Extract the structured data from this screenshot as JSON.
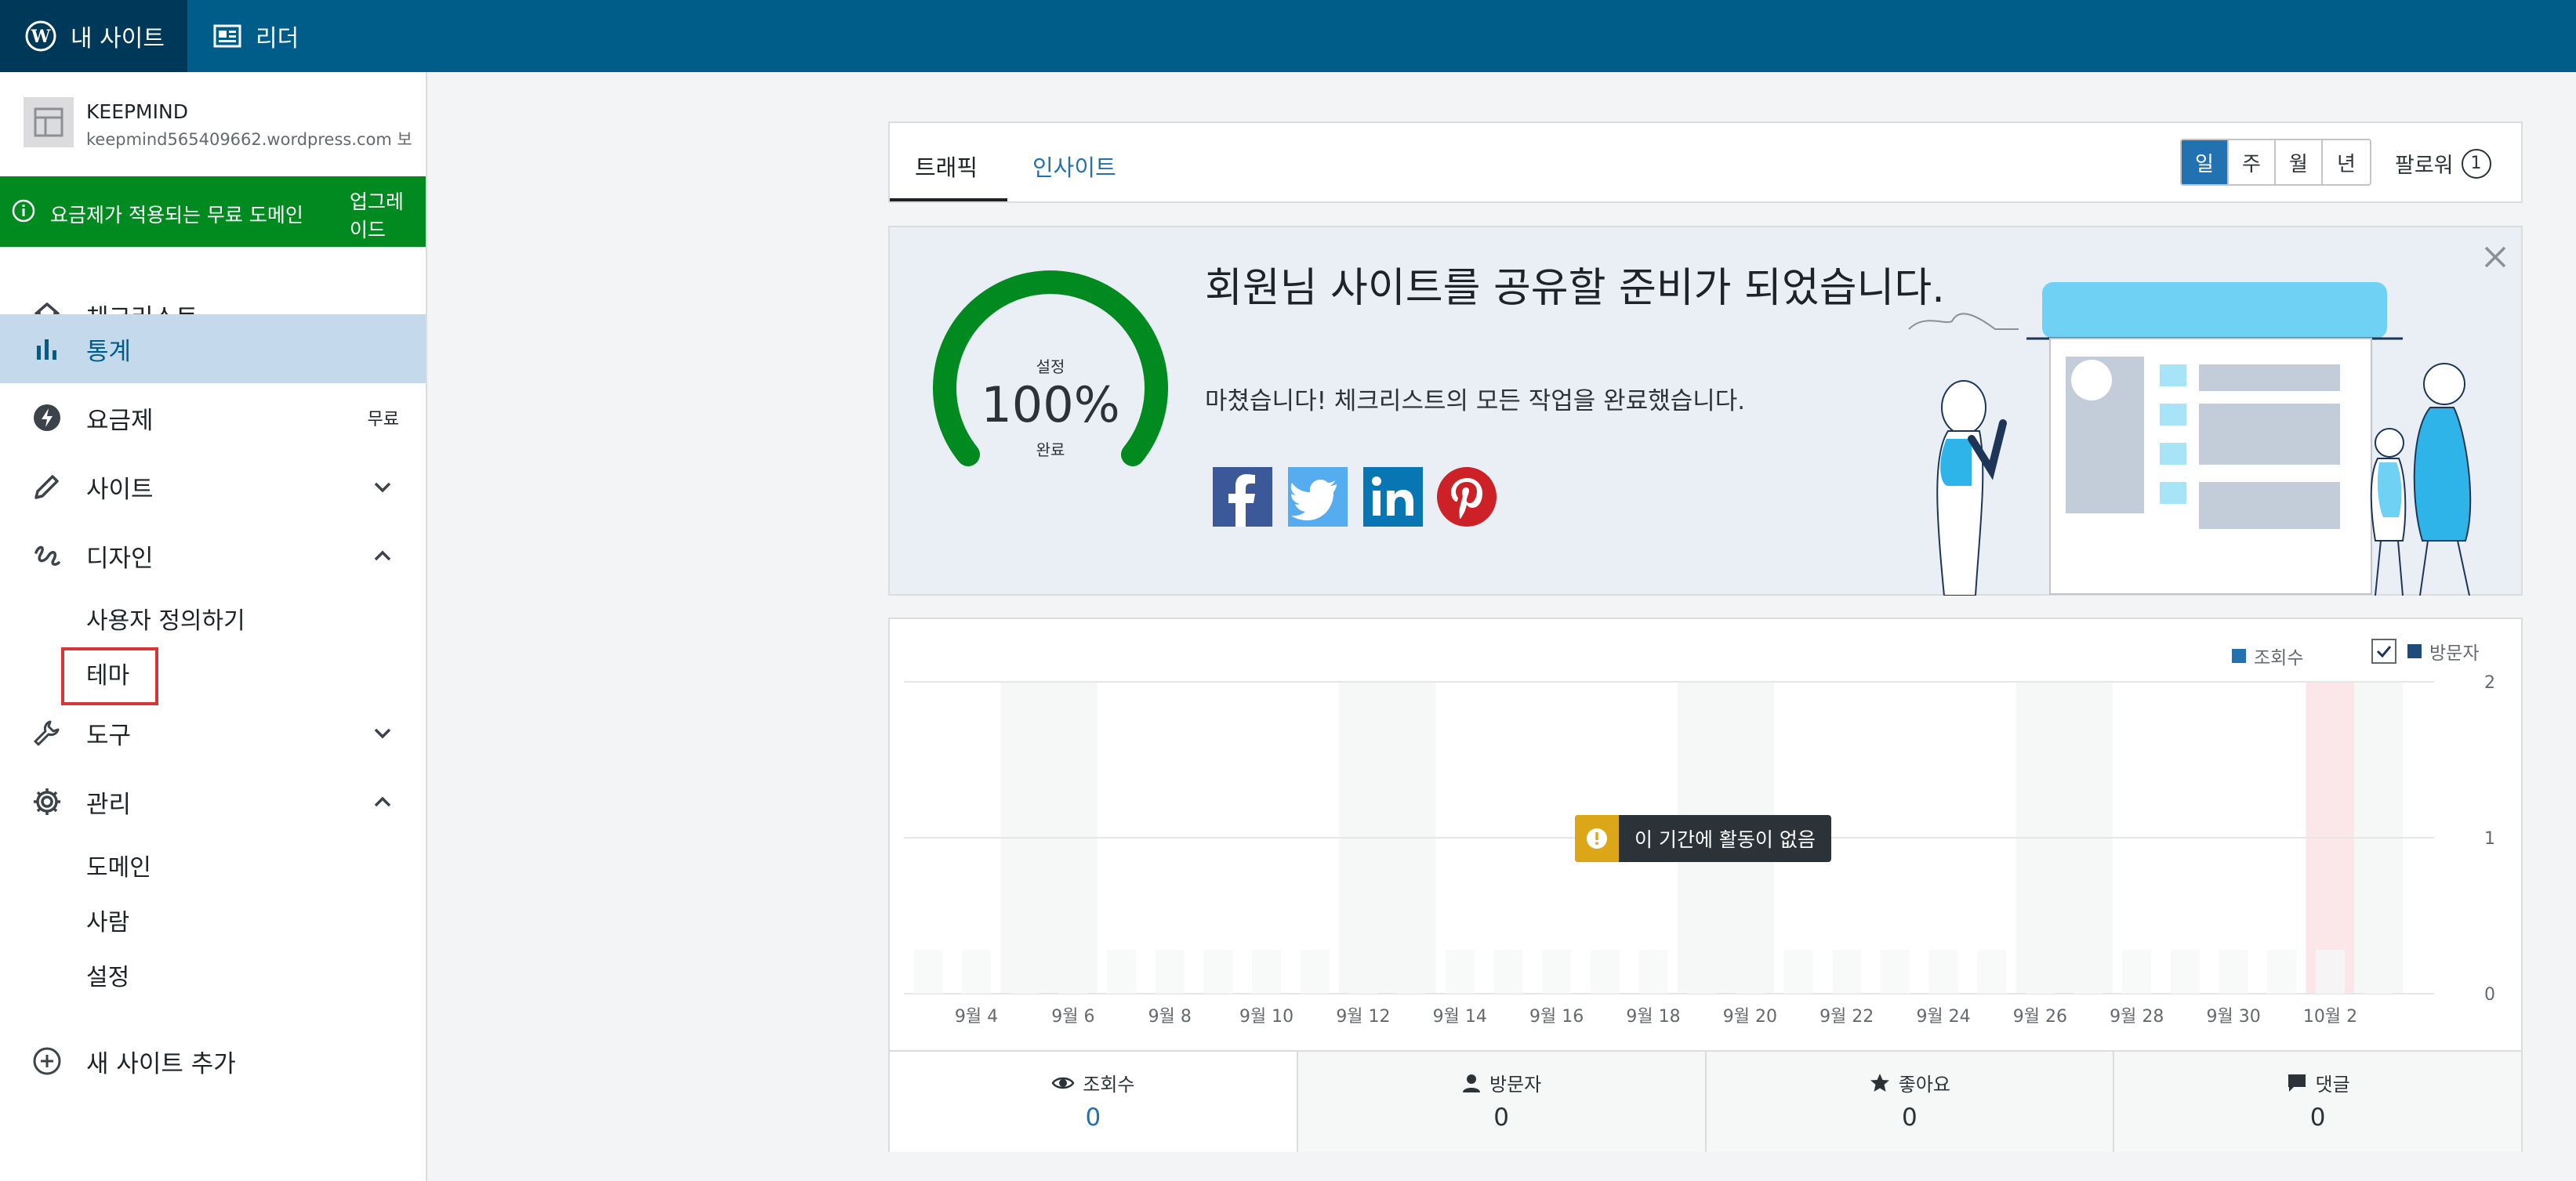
{
  "topbar": {
    "my_site": "내 사이트",
    "reader": "리더"
  },
  "site": {
    "name": "KEEPMIND",
    "url": "keepmind565409662.wordpress.com 보"
  },
  "promo": {
    "text": "요금제가 적용되는 무료 도메인",
    "upgrade": "업그레\n이드"
  },
  "sidebar": {
    "items": [
      {
        "label": "체크리스트",
        "icon": "home-icon"
      },
      {
        "label": "통계",
        "icon": "stats-icon",
        "active": true
      },
      {
        "label": "요금제",
        "icon": "plans-icon",
        "badge": "무료"
      },
      {
        "label": "사이트",
        "icon": "pencil-icon",
        "chevron": "down"
      },
      {
        "label": "디자인",
        "icon": "design-icon",
        "chevron": "up"
      },
      {
        "label": "도구",
        "icon": "wrench-icon",
        "chevron": "down"
      },
      {
        "label": "관리",
        "icon": "gear-icon",
        "chevron": "up"
      }
    ],
    "design_sub": [
      "사용자 정의하기",
      "테마"
    ],
    "manage_sub": [
      "도메인",
      "사람",
      "설정"
    ],
    "add_site": "새 사이트 추가"
  },
  "tabs": {
    "traffic": "트래픽",
    "insight": "인사이트",
    "periods": [
      "일",
      "주",
      "월",
      "년"
    ],
    "active_period": "일",
    "follower_label": "팔로워",
    "follower_count": "1"
  },
  "share": {
    "gauge_top": "설정",
    "gauge_pct": "100%",
    "gauge_bottom": "완료",
    "title": "회원님 사이트를 공유할 준비가 되었습니다.",
    "subtitle": "마쳤습니다! 체크리스트의 모든 작업을 완료했습니다.",
    "socials": [
      "facebook-icon",
      "twitter-icon",
      "linkedin-icon",
      "pinterest-icon"
    ]
  },
  "chart_data": {
    "type": "bar",
    "categories": [
      "9월 3",
      "9월 4",
      "9월 5",
      "9월 6",
      "9월 7",
      "9월 8",
      "9월 9",
      "9월 10",
      "9월 11",
      "9월 12",
      "9월 13",
      "9월 14",
      "9월 15",
      "9월 16",
      "9월 17",
      "9월 18",
      "9월 19",
      "9월 20",
      "9월 21",
      "9월 22",
      "9월 23",
      "9월 24",
      "9월 25",
      "9월 26",
      "9월 27",
      "9월 28",
      "9월 29",
      "9월 30",
      "10월 1",
      "10월 2",
      "10월 3"
    ],
    "tick_labels": [
      "9월 4",
      "9월 6",
      "9월 8",
      "9월 10",
      "9월 12",
      "9월 14",
      "9월 16",
      "9월 18",
      "9월 20",
      "9월 22",
      "9월 24",
      "9월 26",
      "9월 28",
      "9월 30",
      "10월 2"
    ],
    "series": [
      {
        "name": "조회수",
        "values": [
          0,
          0,
          0,
          0,
          0,
          0,
          0,
          0,
          0,
          0,
          0,
          0,
          0,
          0,
          0,
          0,
          0,
          0,
          0,
          0,
          0,
          0,
          0,
          0,
          0,
          0,
          0,
          0,
          0,
          0,
          0
        ]
      },
      {
        "name": "방문자",
        "values": [
          0,
          0,
          0,
          0,
          0,
          0,
          0,
          0,
          0,
          0,
          0,
          0,
          0,
          0,
          0,
          0,
          0,
          0,
          0,
          0,
          0,
          0,
          0,
          0,
          0,
          0,
          0,
          0,
          0,
          0,
          0
        ]
      }
    ],
    "ylim": [
      0,
      2
    ],
    "yticks": [
      "2",
      "1",
      "0"
    ],
    "grid": true,
    "legend": "top-right",
    "highlight_category": "10월 2"
  },
  "chart_legend": {
    "views": "조회수",
    "visitors": "방문자"
  },
  "no_activity": "이 기간에 활동이 없음",
  "stats": [
    {
      "label": "조회수",
      "value": "0",
      "icon": "eye-icon"
    },
    {
      "label": "방문자",
      "value": "0",
      "icon": "person-icon"
    },
    {
      "label": "좋아요",
      "value": "0",
      "icon": "star-icon"
    },
    {
      "label": "댓글",
      "value": "0",
      "icon": "comment-icon"
    }
  ],
  "colors": {
    "topbar": "#005d8a",
    "promo": "#008a20",
    "gauge": "#008a20",
    "accent": "#2271b1"
  }
}
